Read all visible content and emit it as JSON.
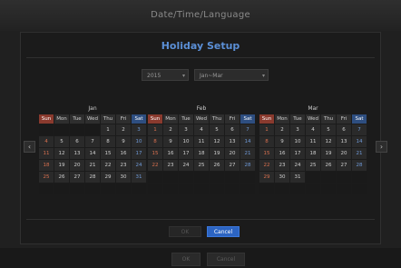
{
  "window": {
    "title": "Date/Time/Language"
  },
  "dialog": {
    "title": "Holiday Setup"
  },
  "year_select": {
    "value": "2015"
  },
  "quarter_select": {
    "value": "Jan~Mar"
  },
  "weekdays": [
    "Sun",
    "Mon",
    "Tue",
    "Wed",
    "Thu",
    "Fri",
    "Sat"
  ],
  "months": [
    {
      "name": "Jan",
      "start": 4,
      "days": 31
    },
    {
      "name": "Feb",
      "start": 0,
      "days": 28
    },
    {
      "name": "Mar",
      "start": 0,
      "days": 31
    }
  ],
  "nav": {
    "prev": "‹",
    "next": "›"
  },
  "buttons": {
    "ok": "OK",
    "cancel": "Cancel"
  },
  "footer": {
    "ok": "OK",
    "cancel": "Cancel"
  },
  "colors": {
    "accent": "#5b8fd6",
    "sunday": "#8a3a2e",
    "saturday": "#2e4e80",
    "cancel_bg": "#2c64c2"
  }
}
